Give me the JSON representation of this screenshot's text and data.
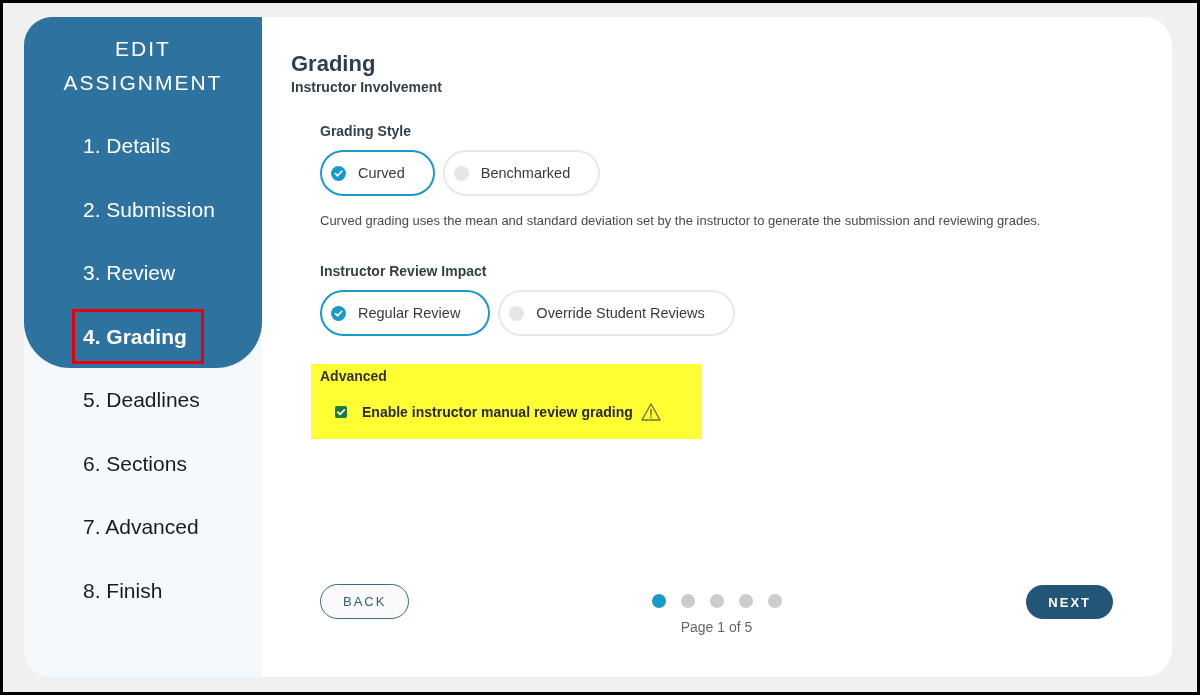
{
  "sidebar": {
    "title": "EDIT ASSIGNMENT",
    "items": [
      {
        "label": "1. Details",
        "selected": false,
        "highlighted": false
      },
      {
        "label": "2. Submission",
        "selected": false,
        "highlighted": false
      },
      {
        "label": "3. Review",
        "selected": false,
        "highlighted": false
      },
      {
        "label": "4. Grading",
        "selected": true,
        "highlighted": true
      },
      {
        "label": "5. Deadlines",
        "selected": false,
        "highlighted": false
      },
      {
        "label": "6. Sections",
        "selected": false,
        "highlighted": false
      },
      {
        "label": "7. Advanced",
        "selected": false,
        "highlighted": false
      },
      {
        "label": "8. Finish",
        "selected": false,
        "highlighted": false
      }
    ]
  },
  "main": {
    "title": "Grading",
    "subtitle": "Instructor Involvement",
    "groups": [
      {
        "label": "Grading Style",
        "options": [
          {
            "label": "Curved",
            "selected": true
          },
          {
            "label": "Benchmarked",
            "selected": false
          }
        ],
        "description": "Curved grading uses the mean and standard deviation set by the instructor to generate the submission and reviewing grades."
      },
      {
        "label": "Instructor Review Impact",
        "options": [
          {
            "label": "Regular Review",
            "selected": true
          },
          {
            "label": "Override Student Reviews",
            "selected": false
          }
        ]
      }
    ],
    "advanced": {
      "title": "Advanced",
      "highlighted": true,
      "checkbox": {
        "label": "Enable instructor manual review grading",
        "checked": true,
        "warning": true
      }
    }
  },
  "footer": {
    "back": "BACK",
    "pages": [
      {
        "selected": true
      },
      {
        "selected": false
      },
      {
        "selected": false
      },
      {
        "selected": false
      },
      {
        "selected": false
      }
    ],
    "page_label": "Page 1 of 5",
    "next": "NEXT"
  }
}
